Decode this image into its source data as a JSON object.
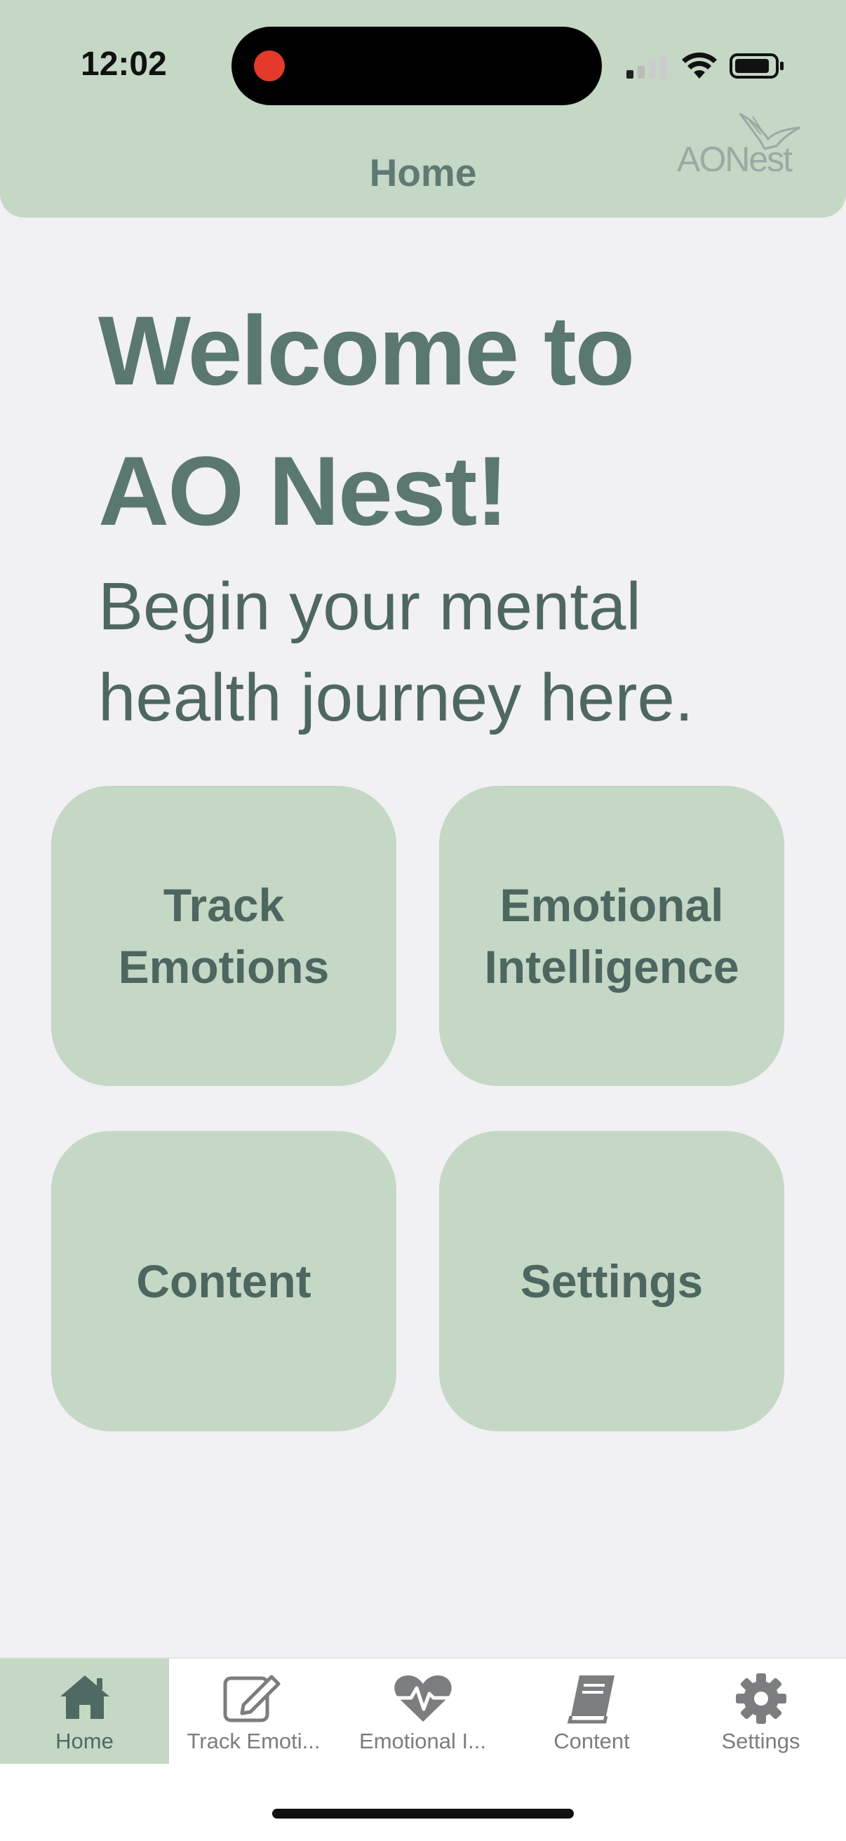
{
  "status_bar": {
    "time": "12:02"
  },
  "header": {
    "title": "Home",
    "logo_text": "AONest"
  },
  "welcome": {
    "title": "Welcome to AO Nest!",
    "subtitle": "Begin your mental health journey here."
  },
  "tiles": [
    {
      "label": "Track Emotions"
    },
    {
      "label": "Emotional Intelligence"
    },
    {
      "label": "Content"
    },
    {
      "label": "Settings"
    }
  ],
  "tabbar": {
    "items": [
      {
        "label": "Home",
        "icon": "home-icon",
        "active": true
      },
      {
        "label": "Track Emoti...",
        "icon": "edit-icon",
        "active": false
      },
      {
        "label": "Emotional I...",
        "icon": "heartbeat-icon",
        "active": false
      },
      {
        "label": "Content",
        "icon": "book-icon",
        "active": false
      },
      {
        "label": "Settings",
        "icon": "gear-icon",
        "active": false
      }
    ]
  },
  "colors": {
    "accent": "#c5d7c5",
    "title_text": "#5a7870",
    "background": "#f1f0f2"
  }
}
